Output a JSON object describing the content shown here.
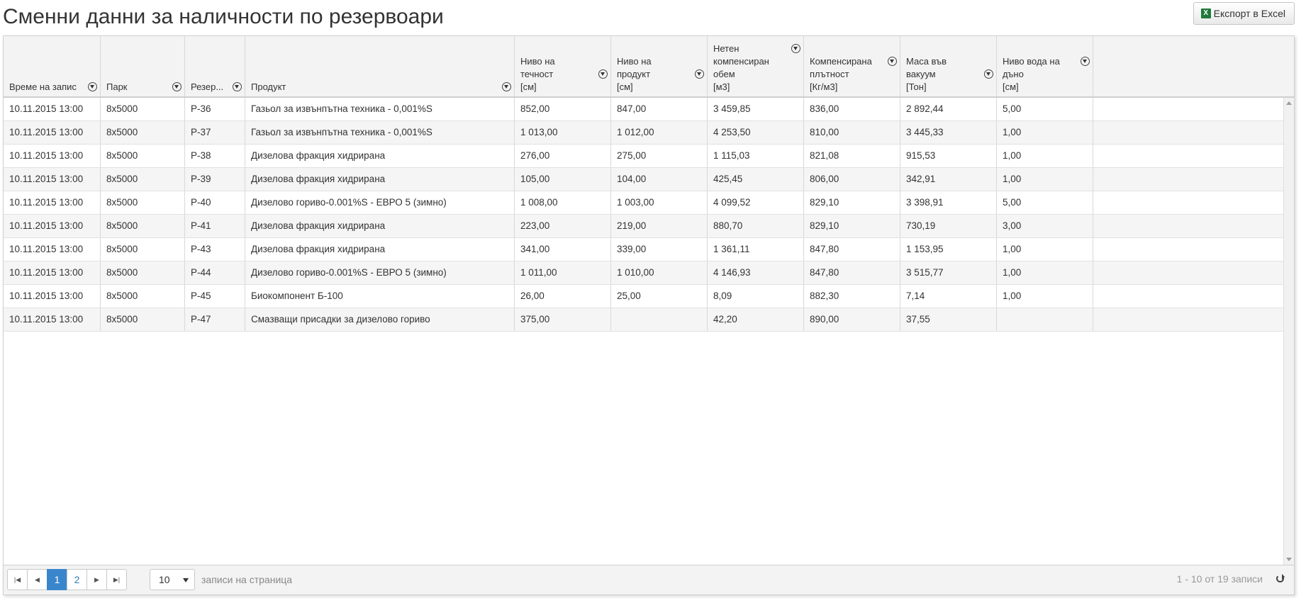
{
  "page": {
    "title": "Сменни данни за наличности по резервоари",
    "export_label": "Експорт в Excel"
  },
  "grid": {
    "columns": [
      {
        "key": "time",
        "label": "Време на запис"
      },
      {
        "key": "park",
        "label": "Парк"
      },
      {
        "key": "tank",
        "label": "Резер..."
      },
      {
        "key": "product",
        "label": "Продукт"
      },
      {
        "key": "liquid",
        "label": "Ниво на течност\n[см]"
      },
      {
        "key": "prodlvl",
        "label": "Ниво на продукт\n[см]"
      },
      {
        "key": "volume",
        "label": "Нетен\nкомпенсиран\nобем\n[м3]"
      },
      {
        "key": "density",
        "label": "Компенсирана\nплътност\n[Кг/м3]"
      },
      {
        "key": "mass",
        "label": "Маса във вакуум\n[Тон]"
      },
      {
        "key": "water",
        "label": "Ниво вода на\nдъно\n[см]"
      }
    ],
    "rows": [
      [
        "10.11.2015 13:00",
        "8x5000",
        "P-36",
        "Газьол за извънпътна техника - 0,001%S",
        "852,00",
        "847,00",
        "3 459,85",
        "836,00",
        "2 892,44",
        "5,00"
      ],
      [
        "10.11.2015 13:00",
        "8x5000",
        "P-37",
        "Газьол за извънпътна техника - 0,001%S",
        "1 013,00",
        "1 012,00",
        "4 253,50",
        "810,00",
        "3 445,33",
        "1,00"
      ],
      [
        "10.11.2015 13:00",
        "8x5000",
        "P-38",
        "Дизелова фракция хидрирана",
        "276,00",
        "275,00",
        "1 115,03",
        "821,08",
        "915,53",
        "1,00"
      ],
      [
        "10.11.2015 13:00",
        "8x5000",
        "P-39",
        "Дизелова фракция хидрирана",
        "105,00",
        "104,00",
        "425,45",
        "806,00",
        "342,91",
        "1,00"
      ],
      [
        "10.11.2015 13:00",
        "8x5000",
        "P-40",
        "Дизелово гориво-0.001%S - ЕВРО 5 (зимно)",
        "1 008,00",
        "1 003,00",
        "4 099,52",
        "829,10",
        "3 398,91",
        "5,00"
      ],
      [
        "10.11.2015 13:00",
        "8x5000",
        "P-41",
        "Дизелова фракция хидрирана",
        "223,00",
        "219,00",
        "880,70",
        "829,10",
        "730,19",
        "3,00"
      ],
      [
        "10.11.2015 13:00",
        "8x5000",
        "P-43",
        "Дизелова фракция хидрирана",
        "341,00",
        "339,00",
        "1 361,11",
        "847,80",
        "1 153,95",
        "1,00"
      ],
      [
        "10.11.2015 13:00",
        "8x5000",
        "P-44",
        "Дизелово гориво-0.001%S - ЕВРО 5 (зимно)",
        "1 011,00",
        "1 010,00",
        "4 146,93",
        "847,80",
        "3 515,77",
        "1,00"
      ],
      [
        "10.11.2015 13:00",
        "8x5000",
        "P-45",
        "Биокомпонент Б-100",
        "26,00",
        "25,00",
        "8,09",
        "882,30",
        "7,14",
        "1,00"
      ],
      [
        "10.11.2015 13:00",
        "8x5000",
        "P-47",
        "Смазващи присадки за дизелово гориво",
        "375,00",
        "",
        "42,20",
        "890,00",
        "37,55",
        ""
      ]
    ]
  },
  "pager": {
    "pages": [
      "1",
      "2"
    ],
    "current_page": "1",
    "page_size": "10",
    "page_size_label": "записи на страница",
    "info": "1 - 10 от 19 записи"
  }
}
